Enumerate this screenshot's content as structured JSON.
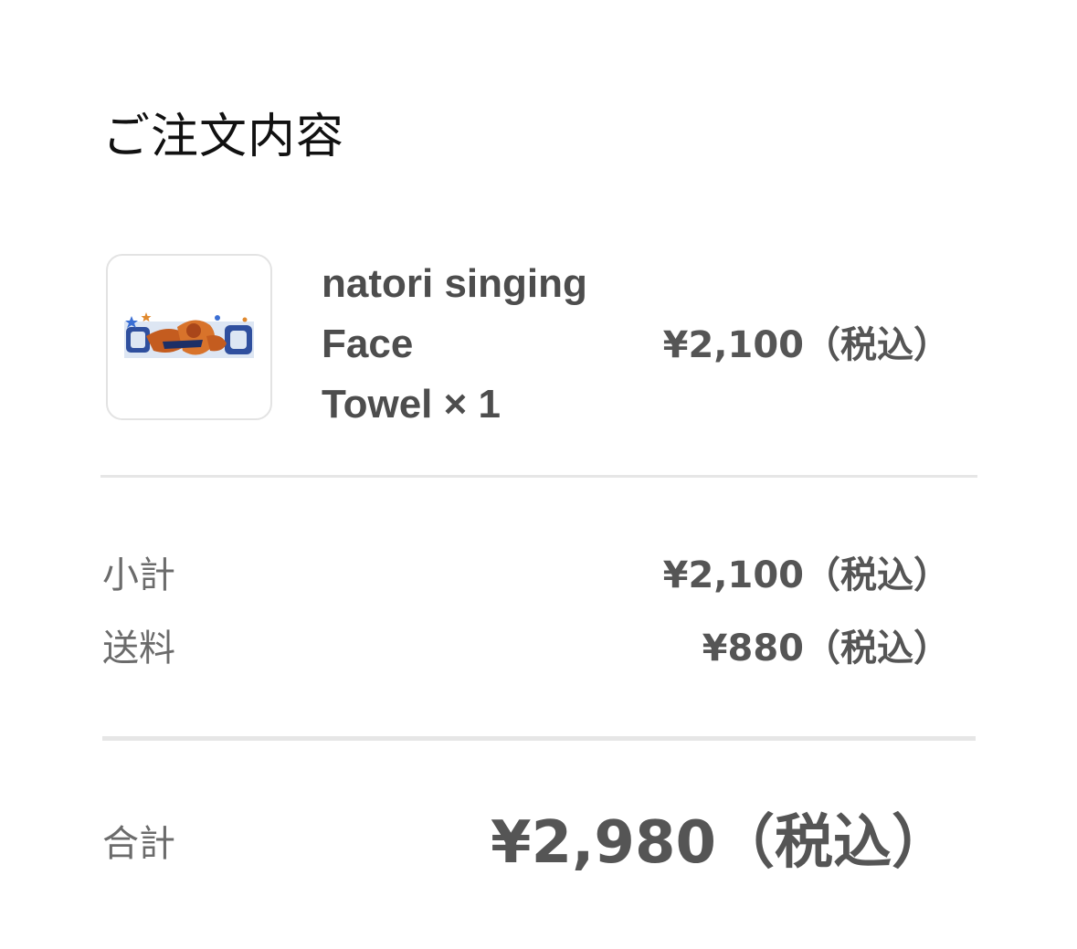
{
  "order": {
    "title": "ご注文内容"
  },
  "item": {
    "name_lines": [
      "natori singing",
      "Face",
      "Towel × 1"
    ],
    "price": "¥2,100（税込）",
    "thumbnail_icon": "face-towel-product-image"
  },
  "summary": {
    "subtotal_label": "小計",
    "subtotal_value": "¥2,100（税込）",
    "shipping_label": "送料",
    "shipping_value": "¥880（税込）"
  },
  "total": {
    "label": "合計",
    "value": "¥2,980（税込）"
  },
  "colors": {
    "title_text": "#111111",
    "body_text": "#555555",
    "label_text": "#6b6b6b",
    "divider": "#e6e6e6",
    "thumb_border": "#e3e3e3"
  }
}
